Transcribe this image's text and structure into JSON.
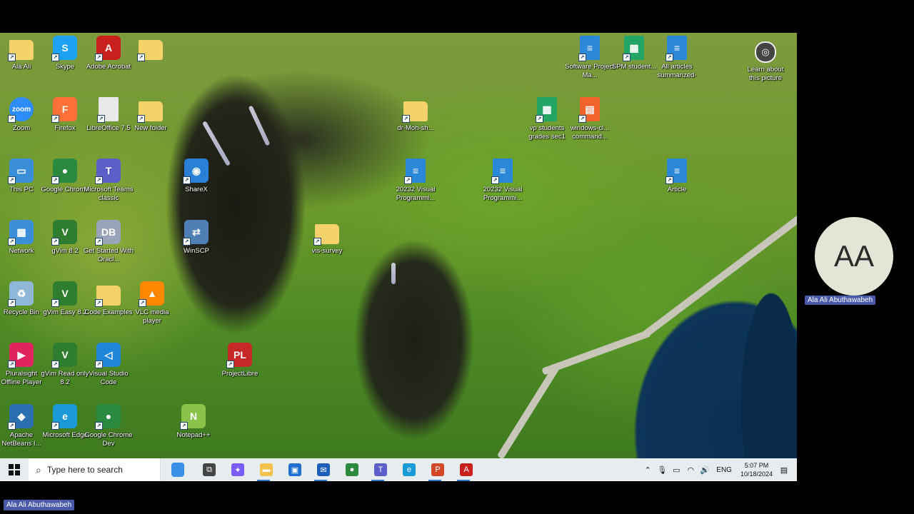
{
  "desktop": {
    "icons": [
      {
        "label": "Ala Ali",
        "kind": "folder-user",
        "color": "#f5d36a"
      },
      {
        "label": "Skype",
        "kind": "app",
        "color": "#1da1f2",
        "glyph": "S"
      },
      {
        "label": "Adobe Acrobat",
        "kind": "app",
        "color": "#c7201d",
        "glyph": "A"
      },
      {
        "label": "",
        "kind": "folder",
        "color": "#f5d36a"
      },
      {
        "label": "Zoom",
        "kind": "app",
        "color": "#2d8cff",
        "glyph": "zoom"
      },
      {
        "label": "Firefox",
        "kind": "app",
        "color": "#ff7139",
        "glyph": "F"
      },
      {
        "label": "LibreOffice 7.5",
        "kind": "doc",
        "color": "#e8e8e8",
        "glyph": ""
      },
      {
        "label": "New folder",
        "kind": "folder",
        "color": "#f5d36a"
      },
      {
        "label": "This PC",
        "kind": "app",
        "color": "#3a8fd8",
        "glyph": "▭"
      },
      {
        "label": "Google Chrome",
        "kind": "app",
        "color": "#2b8a3e",
        "glyph": "●"
      },
      {
        "label": "Microsoft Teams classic",
        "kind": "app",
        "color": "#5b5fc7",
        "glyph": "T"
      },
      {
        "label": "ShareX",
        "kind": "app",
        "color": "#2a7fd6",
        "glyph": "◉"
      },
      {
        "label": "Network",
        "kind": "app",
        "color": "#3a8fd8",
        "glyph": "▦"
      },
      {
        "label": "gVim 8.2",
        "kind": "app",
        "color": "#2f7d2f",
        "glyph": "V"
      },
      {
        "label": "Get Started With Oracl...",
        "kind": "app",
        "color": "#9aa4b8",
        "glyph": "DB"
      },
      {
        "label": "WinSCP",
        "kind": "app",
        "color": "#4f7fb5",
        "glyph": "⇄"
      },
      {
        "label": "vis-survey",
        "kind": "folder",
        "color": "#f5d36a"
      },
      {
        "label": "Recycle Bin",
        "kind": "app",
        "color": "#8fb8d8",
        "glyph": "♻"
      },
      {
        "label": "gVim Easy 8.2",
        "kind": "app",
        "color": "#2f7d2f",
        "glyph": "V"
      },
      {
        "label": "Code Examples",
        "kind": "folder",
        "color": "#f5d36a"
      },
      {
        "label": "VLC media player",
        "kind": "app",
        "color": "#ff8800",
        "glyph": "▲"
      },
      {
        "label": "Pluralsight Offline Player",
        "kind": "app",
        "color": "#e0245e",
        "glyph": "▶"
      },
      {
        "label": "gVim Read only 8.2",
        "kind": "app",
        "color": "#2f7d2f",
        "glyph": "V"
      },
      {
        "label": "Visual Studio Code",
        "kind": "app",
        "color": "#1f86d8",
        "glyph": "◁"
      },
      {
        "label": "ProjectLibre",
        "kind": "app",
        "color": "#c62828",
        "glyph": "PL"
      },
      {
        "label": "Apache NetBeans I...",
        "kind": "app",
        "color": "#2a6fb0",
        "glyph": "◆"
      },
      {
        "label": "Microsoft Edge",
        "kind": "app",
        "color": "#1a9ad6",
        "glyph": "e"
      },
      {
        "label": "Google Chrome Dev",
        "kind": "app",
        "color": "#2b8a3e",
        "glyph": "●"
      },
      {
        "label": "Notepad++",
        "kind": "app",
        "color": "#8bc34a",
        "glyph": "N"
      },
      {
        "label": "dr-Moh-sh...",
        "kind": "folder",
        "color": "#f5d36a"
      },
      {
        "label": "20232 Visual Programmi...",
        "kind": "doc",
        "color": "#2b88d8",
        "glyph": "≡"
      },
      {
        "label": "20232 Visual Programmi...",
        "kind": "doc",
        "color": "#2b88d8",
        "glyph": "≡"
      },
      {
        "label": "Software Project Ma...",
        "kind": "doc",
        "color": "#2b88d8",
        "glyph": "≡"
      },
      {
        "label": "SPM student...",
        "kind": "doc",
        "color": "#22a565",
        "glyph": "▦"
      },
      {
        "label": "All articles summarized-",
        "kind": "doc",
        "color": "#2b88d8",
        "glyph": "≡"
      },
      {
        "label": "vp students grades sec1",
        "kind": "doc",
        "color": "#22a565",
        "glyph": "▦"
      },
      {
        "label": "windows-cl... command...",
        "kind": "doc",
        "color": "#f0642c",
        "glyph": "▤"
      },
      {
        "label": "Article",
        "kind": "doc",
        "color": "#2b88d8",
        "glyph": "≡"
      }
    ],
    "learn_about": "Learn about this picture"
  },
  "taskbar": {
    "search_placeholder": "Type here to search",
    "pinned": [
      {
        "name": "task-view",
        "color": "#444",
        "glyph": "⧉"
      },
      {
        "name": "copilot",
        "color": "#7b5cff",
        "glyph": "✦"
      },
      {
        "name": "file-explorer",
        "color": "#f2c14e",
        "glyph": "▬"
      },
      {
        "name": "microsoft-store",
        "color": "#1f6fd0",
        "glyph": "▣"
      },
      {
        "name": "mail",
        "color": "#1d5fb8",
        "glyph": "✉"
      },
      {
        "name": "chrome",
        "color": "#2b8a3e",
        "glyph": "●"
      },
      {
        "name": "teams",
        "color": "#5b5fc7",
        "glyph": "T"
      },
      {
        "name": "edge",
        "color": "#1a9ad6",
        "glyph": "e"
      },
      {
        "name": "powerpoint",
        "color": "#d24726",
        "glyph": "P"
      },
      {
        "name": "acrobat",
        "color": "#c7201d",
        "glyph": "A"
      }
    ],
    "lang": "ENG",
    "time": "5:07 PM",
    "date": "10/18/2024"
  },
  "meeting": {
    "avatar_initials": "AA",
    "participant_name": "Ala Ali Abuthawabeh",
    "presenter_name": "Ala Ali Abuthawabeh"
  }
}
